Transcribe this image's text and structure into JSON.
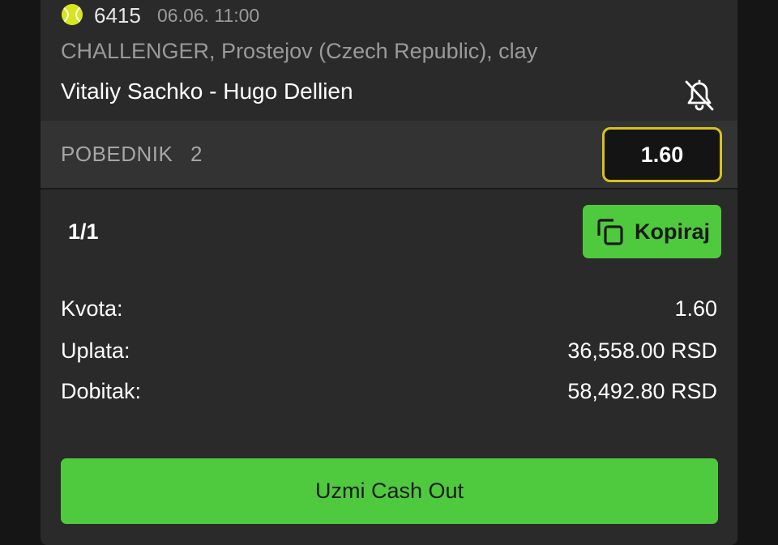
{
  "match": {
    "sport_icon": "tennis-ball-icon",
    "id": "6415",
    "datetime": "06.06. 11:00",
    "league": "CHALLENGER, Prostejov (Czech Republic), clay",
    "players": "Vitaliy Sachko - Hugo Dellien",
    "notification_icon": "bell-off-icon"
  },
  "bet": {
    "market": "POBEDNIK",
    "pick": "2",
    "odds": "1.60"
  },
  "ticket": {
    "fraction": "1/1",
    "copy_icon": "copy-icon",
    "copy_label": "Kopiraj",
    "rows": [
      {
        "label": "Kvota:",
        "value": "1.60"
      },
      {
        "label": "Uplata:",
        "value": "36,558.00 RSD"
      },
      {
        "label": "Dobitak:",
        "value": "58,492.80 RSD"
      }
    ],
    "cashout_label": "Uzmi Cash Out"
  },
  "colors": {
    "accent_green": "#4fca3e",
    "odds_border": "#d6c21e",
    "tennis_ball": "#d6e51e",
    "background": "#151515",
    "card": "#2a2a2a"
  }
}
